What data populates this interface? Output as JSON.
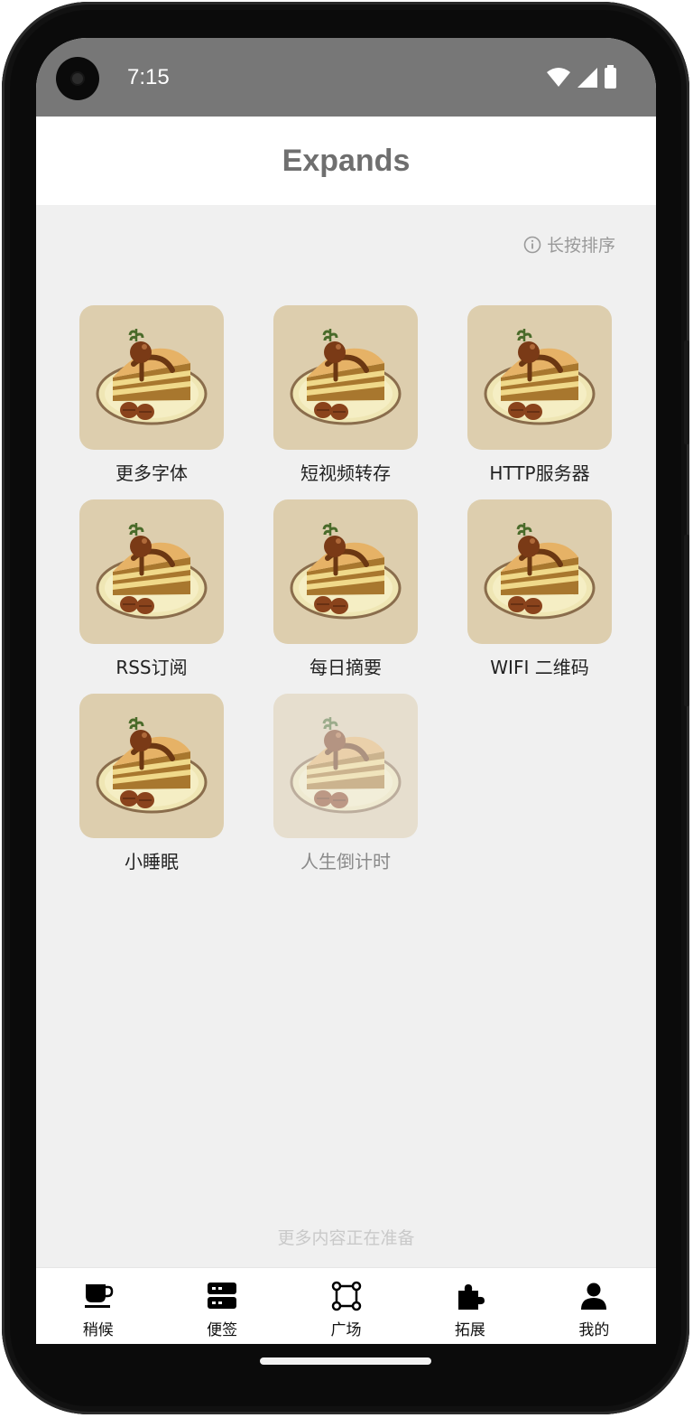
{
  "status_bar": {
    "time": "7:15"
  },
  "header": {
    "title": "Expands"
  },
  "hint": {
    "text": "长按排序"
  },
  "grid": {
    "items": [
      {
        "label": "更多字体",
        "enabled": true
      },
      {
        "label": "短视频转存",
        "enabled": true
      },
      {
        "label": "HTTP服务器",
        "enabled": true
      },
      {
        "label": "RSS订阅",
        "enabled": true
      },
      {
        "label": "每日摘要",
        "enabled": true
      },
      {
        "label": "WIFI 二维码",
        "enabled": true
      },
      {
        "label": "小睡眠",
        "enabled": true
      },
      {
        "label": "人生倒计时",
        "enabled": false
      }
    ]
  },
  "footer": {
    "note": "更多内容正在准备"
  },
  "bottom_nav": {
    "items": [
      {
        "label": "稍候",
        "icon": "cup-icon"
      },
      {
        "label": "便签",
        "icon": "notes-icon"
      },
      {
        "label": "广场",
        "icon": "square-nodes-icon"
      },
      {
        "label": "拓展",
        "icon": "puzzle-icon"
      },
      {
        "label": "我的",
        "icon": "person-icon"
      }
    ]
  },
  "colors": {
    "status_bar": "#777777",
    "tile_bg": "#ddceae",
    "page_bg": "#f0f0f0"
  }
}
